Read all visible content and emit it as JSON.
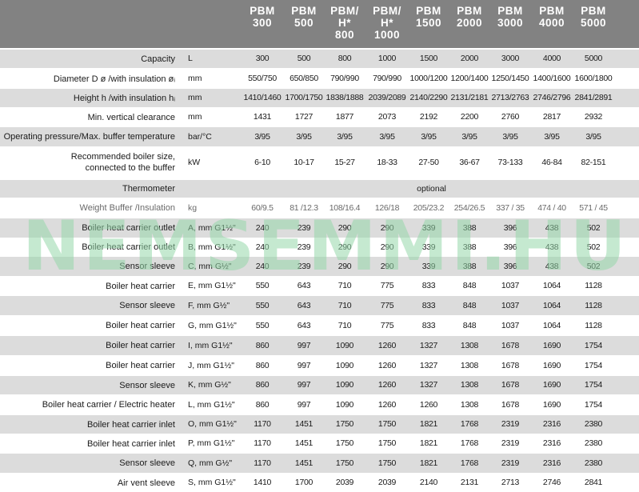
{
  "header": {
    "columns": [
      [
        "PBM",
        "300"
      ],
      [
        "PBM",
        "500"
      ],
      [
        "PBM/",
        "H*",
        "800"
      ],
      [
        "PBM/",
        "H*",
        "1000"
      ],
      [
        "PBM",
        "1500"
      ],
      [
        "PBM",
        "2000"
      ],
      [
        "PBM",
        "3000"
      ],
      [
        "PBM",
        "4000"
      ],
      [
        "PBM",
        "5000"
      ]
    ]
  },
  "rows": [
    {
      "label": [
        "Capacity"
      ],
      "unit": "L",
      "values": [
        "300",
        "500",
        "800",
        "1000",
        "1500",
        "2000",
        "3000",
        "4000",
        "5000"
      ]
    },
    {
      "label": [
        "Diameter D ø /with insulation øᵢ"
      ],
      "unit": "mm",
      "values": [
        "550/750",
        "650/850",
        "790/990",
        "790/990",
        "1000/1200",
        "1200/1400",
        "1250/1450",
        "1400/1600",
        "1600/1800"
      ]
    },
    {
      "label": [
        "Height h /with insulation hᵢ"
      ],
      "unit": "mm",
      "values": [
        "1410/1460",
        "1700/1750",
        "1838/1888",
        "2039/2089",
        "2140/2290",
        "2131/2181",
        "2713/2763",
        "2746/2796",
        "2841/2891"
      ]
    },
    {
      "label": [
        "Min. vertical clearance"
      ],
      "unit": "mm",
      "values": [
        "1431",
        "1727",
        "1877",
        "2073",
        "2192",
        "2200",
        "2760",
        "2817",
        "2932"
      ]
    },
    {
      "label": [
        "Operating pressure/Max. buffer temperature"
      ],
      "unit": "bar/°C",
      "values": [
        "3/95",
        "3/95",
        "3/95",
        "3/95",
        "3/95",
        "3/95",
        "3/95",
        "3/95",
        "3/95"
      ]
    },
    {
      "label": [
        "Recommended boiler size,",
        "connected to the buffer"
      ],
      "unit": "kW",
      "values": [
        "6-10",
        "10-17",
        "15-27",
        "18-33",
        "27-50",
        "36-67",
        "73-133",
        "46-84",
        "82-151"
      ]
    },
    {
      "label": [
        "Thermometer"
      ],
      "unit": "",
      "merged": "optional"
    },
    {
      "label": [
        "Weight Buffer /Insulation"
      ],
      "unit": "kg",
      "values": [
        "60/9.5",
        "81 /12.3",
        "108/16.4",
        "126/18",
        "205/23.2",
        "254/26.5",
        "337 / 35",
        "474 / 40",
        "571 / 45"
      ],
      "light": true
    },
    {
      "label": [
        "Boiler heat carrier outlet"
      ],
      "unit": "A, mm  G1½\"",
      "values": [
        "240",
        "239",
        "290",
        "290",
        "339",
        "388",
        "396",
        "438",
        "502"
      ]
    },
    {
      "label": [
        "Boiler heat carrier outlet"
      ],
      "unit": "B, mm  G1½\"",
      "values": [
        "240",
        "239",
        "290",
        "290",
        "339",
        "388",
        "396",
        "438",
        "502"
      ]
    },
    {
      "label": [
        "Sensor sleeve"
      ],
      "unit": "C, mm  G½\"",
      "values": [
        "240",
        "239",
        "290",
        "290",
        "339",
        "388",
        "396",
        "438",
        "502"
      ]
    },
    {
      "label": [
        "Boiler heat carrier"
      ],
      "unit": "E, mm  G1½\"",
      "values": [
        "550",
        "643",
        "710",
        "775",
        "833",
        "848",
        "1037",
        "1064",
        "1128"
      ]
    },
    {
      "label": [
        "Sensor sleeve"
      ],
      "unit": "F, mm  G½\"",
      "values": [
        "550",
        "643",
        "710",
        "775",
        "833",
        "848",
        "1037",
        "1064",
        "1128"
      ]
    },
    {
      "label": [
        "Boiler heat carrier"
      ],
      "unit": "G, mm G1½\"",
      "values": [
        "550",
        "643",
        "710",
        "775",
        "833",
        "848",
        "1037",
        "1064",
        "1128"
      ]
    },
    {
      "label": [
        "Boiler heat carrier"
      ],
      "unit": "I, mm  G1½\"",
      "values": [
        "860",
        "997",
        "1090",
        "1260",
        "1327",
        "1308",
        "1678",
        "1690",
        "1754"
      ]
    },
    {
      "label": [
        "Boiler heat carrier"
      ],
      "unit": "J, mm  G1½\"",
      "values": [
        "860",
        "997",
        "1090",
        "1260",
        "1327",
        "1308",
        "1678",
        "1690",
        "1754"
      ]
    },
    {
      "label": [
        "Sensor sleeve"
      ],
      "unit": "K, mm  G½\"",
      "values": [
        "860",
        "997",
        "1090",
        "1260",
        "1327",
        "1308",
        "1678",
        "1690",
        "1754"
      ]
    },
    {
      "label": [
        "Boiler heat carrier / Electric heater"
      ],
      "unit": "L, mm  G1½\"",
      "values": [
        "860",
        "997",
        "1090",
        "1260",
        "1260",
        "1308",
        "1678",
        "1690",
        "1754"
      ]
    },
    {
      "label": [
        "Boiler heat carrier inlet"
      ],
      "unit": "O, mm G1½\"",
      "values": [
        "1170",
        "1451",
        "1750",
        "1750",
        "1821",
        "1768",
        "2319",
        "2316",
        "2380"
      ]
    },
    {
      "label": [
        "Boiler heat carrier inlet"
      ],
      "unit": "P, mm G1½\"",
      "values": [
        "1170",
        "1451",
        "1750",
        "1750",
        "1821",
        "1768",
        "2319",
        "2316",
        "2380"
      ]
    },
    {
      "label": [
        "Sensor sleeve"
      ],
      "unit": "Q, mm  G½\"",
      "values": [
        "1170",
        "1451",
        "1750",
        "1750",
        "1821",
        "1768",
        "2319",
        "2316",
        "2380"
      ]
    },
    {
      "label": [
        "Air vent sleeve"
      ],
      "unit": "S, mm  G1½\"",
      "values": [
        "1410",
        "1700",
        "2039",
        "2039",
        "2140",
        "2131",
        "2713",
        "2746",
        "2841"
      ]
    }
  ],
  "watermark": "NEMSEMMI.HU"
}
